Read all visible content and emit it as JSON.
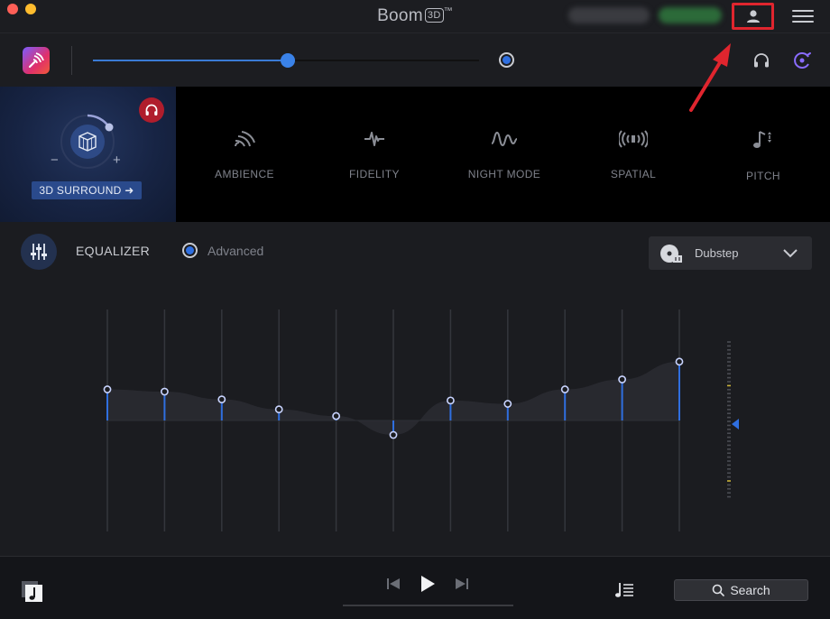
{
  "window": {
    "title_word": "Boom",
    "title_badge": "3D",
    "title_tm": "™"
  },
  "volume": {
    "level": 0.505,
    "output_icon": "headphones-icon",
    "output_device_icon": "audio-output-icon"
  },
  "surround": {
    "button_label": "3D SURROUND ➜",
    "minus": "−",
    "plus": "+",
    "badge_icon": "headphones-icon"
  },
  "effects": [
    {
      "id": "ambience",
      "label": "AMBIENCE",
      "icon": "ambience-icon"
    },
    {
      "id": "fidelity",
      "label": "FIDELITY",
      "icon": "fidelity-icon"
    },
    {
      "id": "night-mode",
      "label": "NIGHT MODE",
      "icon": "night-mode-icon"
    },
    {
      "id": "spatial",
      "label": "SPATIAL",
      "icon": "spatial-icon"
    },
    {
      "id": "pitch",
      "label": "PITCH",
      "icon": "pitch-icon"
    }
  ],
  "equalizer": {
    "title": "EQUALIZER",
    "advanced_label": "Advanced",
    "advanced_selected": true,
    "preset": "Dubstep",
    "bands": [
      0.28,
      0.26,
      0.19,
      0.1,
      0.04,
      -0.13,
      0.18,
      0.15,
      0.28,
      0.37,
      0.53
    ],
    "preamp": 0.0
  },
  "footer": {
    "search_label": "Search"
  },
  "colors": {
    "accent": "#2f6fe0",
    "highlight": "#e0252e",
    "badge": "#b01d2c",
    "brand_gradient_start": "#7b5cff",
    "brand_gradient_end": "#f05a3a"
  }
}
